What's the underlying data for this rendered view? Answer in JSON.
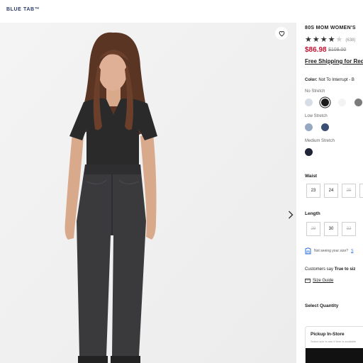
{
  "header": {
    "brand": "BLUE TAB™"
  },
  "product": {
    "title": "80S MOM WOMEN'S",
    "review_count": "(638)",
    "rating": 3.5,
    "price": "$86.98",
    "original_price": "$109.00",
    "shipping": "Free Shipping for Red"
  },
  "color": {
    "label": "Color:",
    "value": "Not To Interrupt - B",
    "groups": [
      {
        "name": "No Stretch",
        "swatches": [
          "#d7dde6",
          "#1c1c1c",
          "#f3f3f3",
          "#7b7b7b"
        ]
      },
      {
        "name": "Low Stretch",
        "swatches": [
          "#97a9c1",
          "#3b4e74"
        ]
      },
      {
        "name": "Medium Stretch",
        "swatches": [
          "#1f2537"
        ]
      }
    ]
  },
  "waist": {
    "label": "Waist",
    "sizes": [
      "23",
      "24",
      "25"
    ]
  },
  "length": {
    "label": "Length",
    "sizes": [
      "28",
      "30",
      "32"
    ]
  },
  "fit": {
    "text": "Not seeing your size?",
    "link": "S"
  },
  "customers": {
    "text": "Customers say",
    "bold": "True to siz"
  },
  "size_guide": "Size Guide",
  "quantity": "Select Quantity",
  "pickup": {
    "title": "Pickup In-Store",
    "subtitle": "Select size to see if item is available"
  }
}
